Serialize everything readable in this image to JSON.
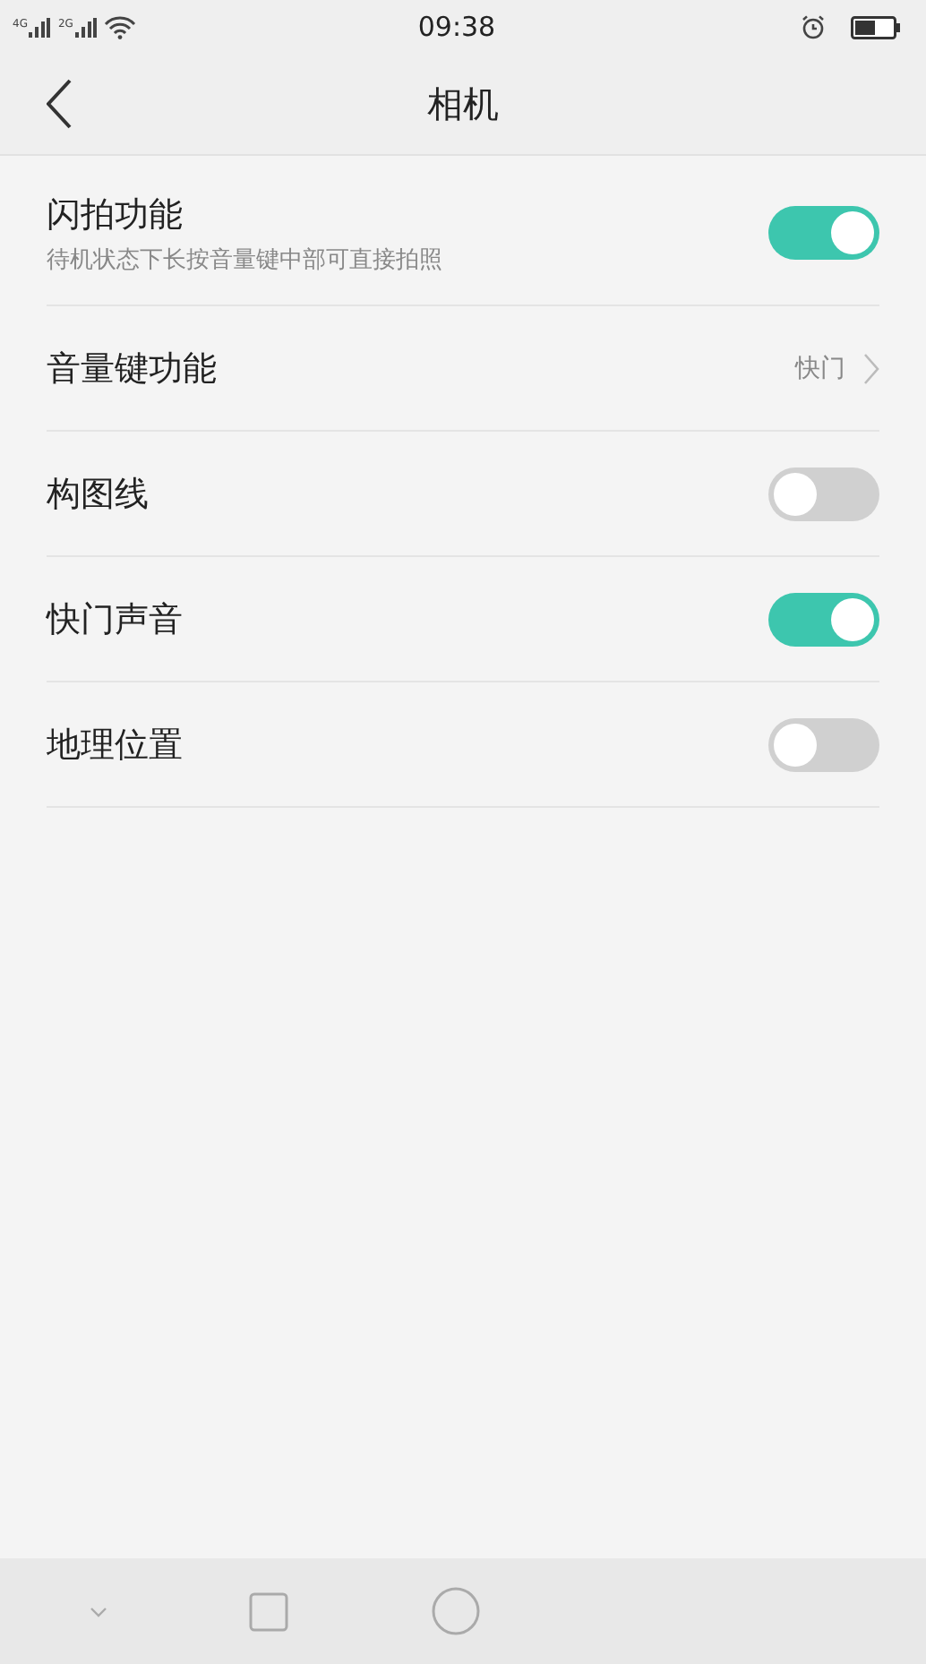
{
  "status_bar": {
    "network_1": "4G",
    "network_2": "2G",
    "time": "09:38"
  },
  "header": {
    "title": "相机"
  },
  "settings": [
    {
      "kind": "toggle",
      "label": "闪拍功能",
      "description": "待机状态下长按音量键中部可直接拍照",
      "on": true
    },
    {
      "kind": "link",
      "label": "音量键功能",
      "value": "快门"
    },
    {
      "kind": "toggle",
      "label": "构图线",
      "on": false
    },
    {
      "kind": "toggle",
      "label": "快门声音",
      "on": true
    },
    {
      "kind": "toggle",
      "label": "地理位置",
      "on": false
    }
  ]
}
